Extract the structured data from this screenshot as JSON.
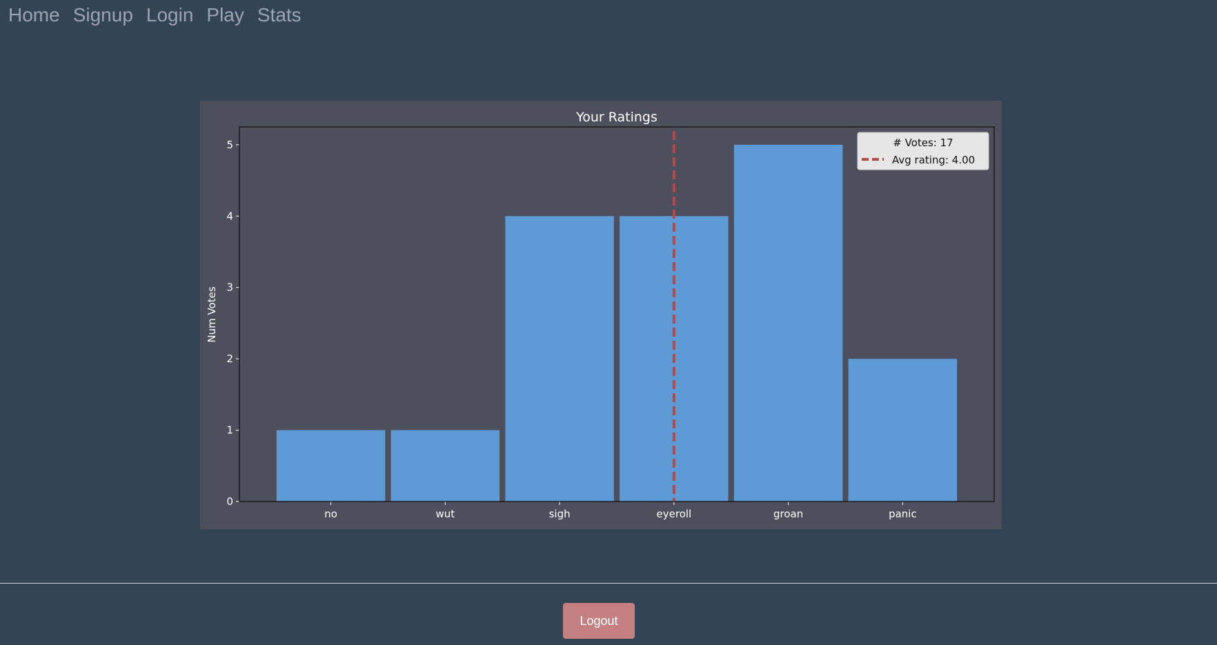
{
  "nav": {
    "items": [
      {
        "label": "Home"
      },
      {
        "label": "Signup"
      },
      {
        "label": "Login"
      },
      {
        "label": "Play"
      },
      {
        "label": "Stats"
      }
    ]
  },
  "chart_data": {
    "type": "bar",
    "title": "Your Ratings",
    "xlabel": "",
    "ylabel": "Num Votes",
    "categories": [
      "no",
      "wut",
      "sigh",
      "eyeroll",
      "groan",
      "panic"
    ],
    "values": [
      1,
      1,
      4,
      4,
      5,
      2
    ],
    "ylim": [
      0,
      5.25
    ],
    "yticks": [
      0,
      1,
      2,
      3,
      4,
      5
    ],
    "grid": false,
    "avg_line": {
      "x": 4.0
    },
    "legend": {
      "placement": "top-right",
      "title": "# Votes: 17",
      "entries": [
        {
          "label": "Avg rating: 4.00",
          "style": "dashed"
        }
      ]
    },
    "colors": {
      "bar": "#5e9bd6",
      "avg_line": "#b54848",
      "plot_background": "#4d505c",
      "text": "#ffffff"
    }
  },
  "footer": {
    "logout_label": "Logout"
  },
  "colors": {
    "page_background": "#334455",
    "nav_link": "#9aa5b1",
    "logout_button": "#c47f80"
  }
}
